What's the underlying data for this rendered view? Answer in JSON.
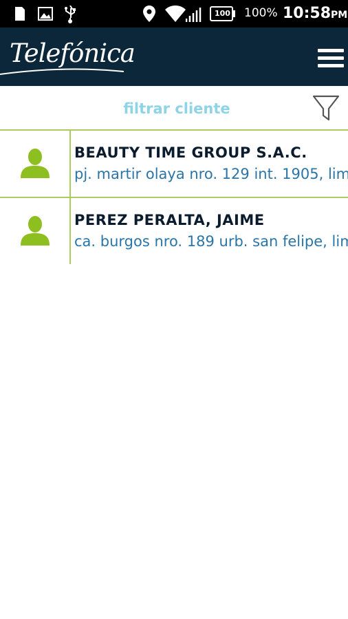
{
  "status_bar": {
    "battery_percent": "100%",
    "battery_icon_label": "100",
    "time": "10:58",
    "ampm": "PM",
    "icons": [
      "sim-icon",
      "image-icon",
      "usb-icon",
      "location-icon",
      "wifi-icon",
      "signal-icon",
      "battery-icon"
    ]
  },
  "app_bar": {
    "logo_text": "Telefónica",
    "menu_icon": "hamburger-menu-icon"
  },
  "filter": {
    "placeholder": "filtrar cliente",
    "value": "",
    "icon": "funnel-filter-icon"
  },
  "clients": [
    {
      "name": "BEAUTY TIME GROUP S.A.C.",
      "address": "pj. martir olaya nro. 129 int. 1905, lim",
      "icon": "user-icon"
    },
    {
      "name": "PEREZ PERALTA, JAIME",
      "address": "ca. burgos nro. 189 urb. san felipe, lim",
      "icon": "user-icon"
    }
  ],
  "colors": {
    "status_bar": "#000000",
    "app_bar": "#0b2739",
    "accent_green": "#8cbf1f",
    "divider": "#a9cc5c",
    "address_blue": "#2a75a8",
    "placeholder_cyan": "#8fd3e6"
  }
}
